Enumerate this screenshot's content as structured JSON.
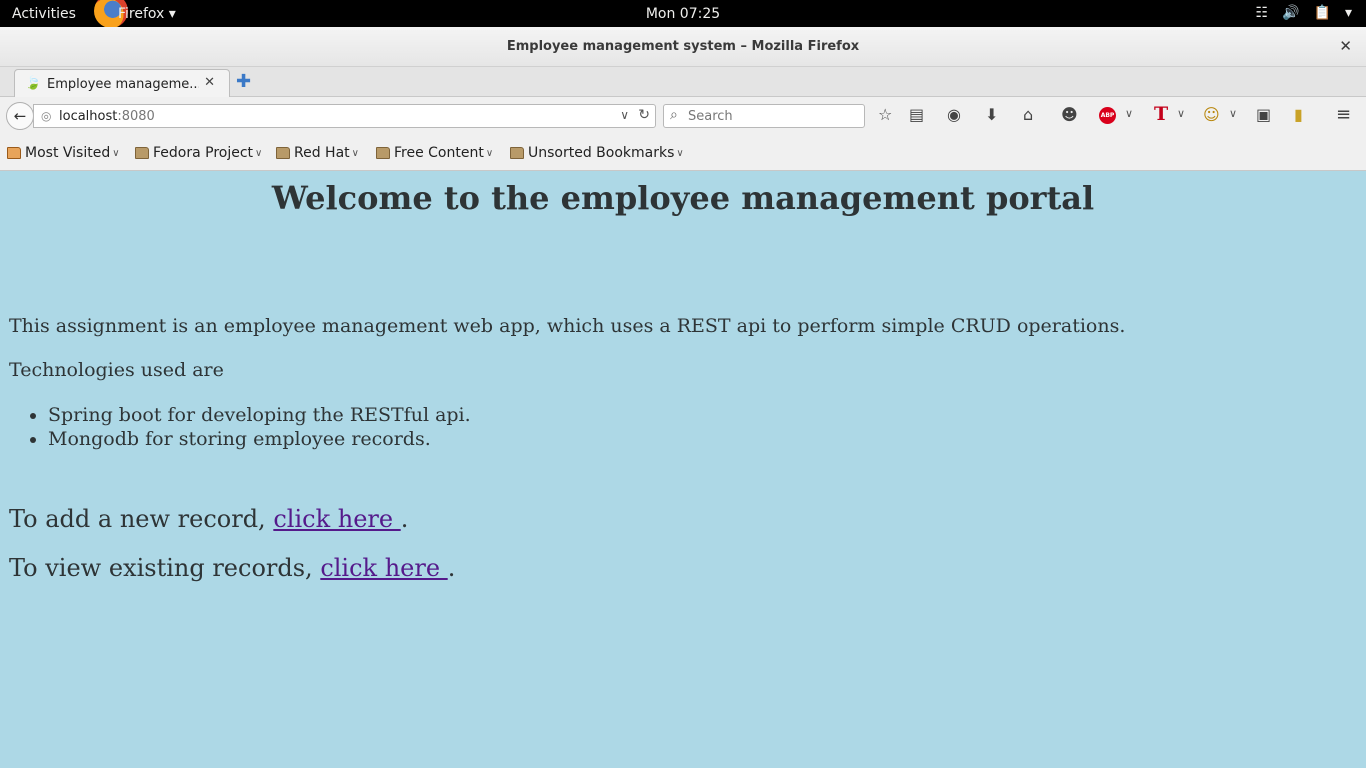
{
  "system_bar": {
    "activities": "Activities",
    "app_name": "Firefox ▾",
    "clock": "Mon 07:25",
    "tray_icons": [
      "wifi-icon",
      "volume-icon",
      "battery-icon"
    ],
    "tray_menu_caret": "▾"
  },
  "window": {
    "title": "Employee management system – Mozilla Firefox",
    "close": "✕"
  },
  "tabs": [
    {
      "label": "Employee manageme...",
      "close": "✕",
      "favicon": "spring-leaf-icon"
    }
  ],
  "new_tab": "✚",
  "navbar": {
    "url_host": "localhost",
    "url_port": ":8080",
    "search_placeholder": "Search"
  },
  "bookmarks": [
    {
      "label": "Most Visited"
    },
    {
      "label": "Fedora Project"
    },
    {
      "label": "Red Hat"
    },
    {
      "label": "Free Content"
    },
    {
      "label": "Unsorted Bookmarks"
    }
  ],
  "page": {
    "heading": "Welcome to the employee management portal",
    "intro": "This assignment is an employee management web app, which uses a REST api to perform simple CRUD operations.",
    "tech_heading": "Technologies used are",
    "technologies": [
      "Spring boot for developing the RESTful api.",
      "Mongodb for storing employee records."
    ],
    "add_prefix": "To add a new record, ",
    "add_link": "click here ",
    "add_suffix": ".",
    "view_prefix": "To view existing records, ",
    "view_link": "click here ",
    "view_suffix": "."
  },
  "colors": {
    "page_background": "#add8e6",
    "link_visited": "#551a8b"
  }
}
